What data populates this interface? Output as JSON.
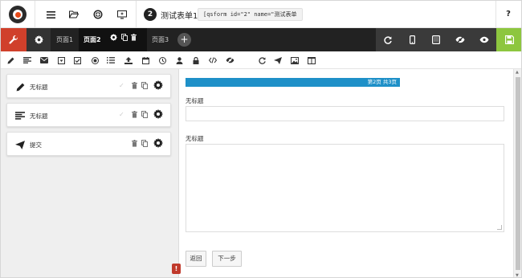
{
  "header": {
    "form_number": "2",
    "form_title": "测试表单1",
    "shortcode": "[qsform id=\"2\" name=\"测试表单",
    "help_label": "?"
  },
  "icons": {
    "menu": "menu-icon",
    "folder": "folder-open-icon",
    "add": "add-circle-icon",
    "preview": "monitor-icon"
  },
  "pages": {
    "tabs": [
      {
        "label": "页面1",
        "active": false
      },
      {
        "label": "页面2",
        "active": true
      },
      {
        "label": "页面3",
        "active": false
      }
    ],
    "add_label": "+"
  },
  "colors": {
    "accent_red": "#d0402b",
    "save_green": "#8dc63f",
    "progress_blue": "#1e90c8",
    "dark_bar": "#222222"
  },
  "fields": [
    {
      "label": "无标题",
      "icon": "pencil-icon",
      "has_check": true
    },
    {
      "label": "无标题",
      "icon": "paragraph-icon",
      "has_check": true
    },
    {
      "label": "提交",
      "icon": "send-icon",
      "has_check": false
    }
  ],
  "preview": {
    "progress_text": "第2页 共3页",
    "progress_fraction": 0.667,
    "q1_label": "无标题",
    "q2_label": "无标题",
    "back_label": "返回",
    "next_label": "下一步"
  },
  "warning_badge": "!"
}
